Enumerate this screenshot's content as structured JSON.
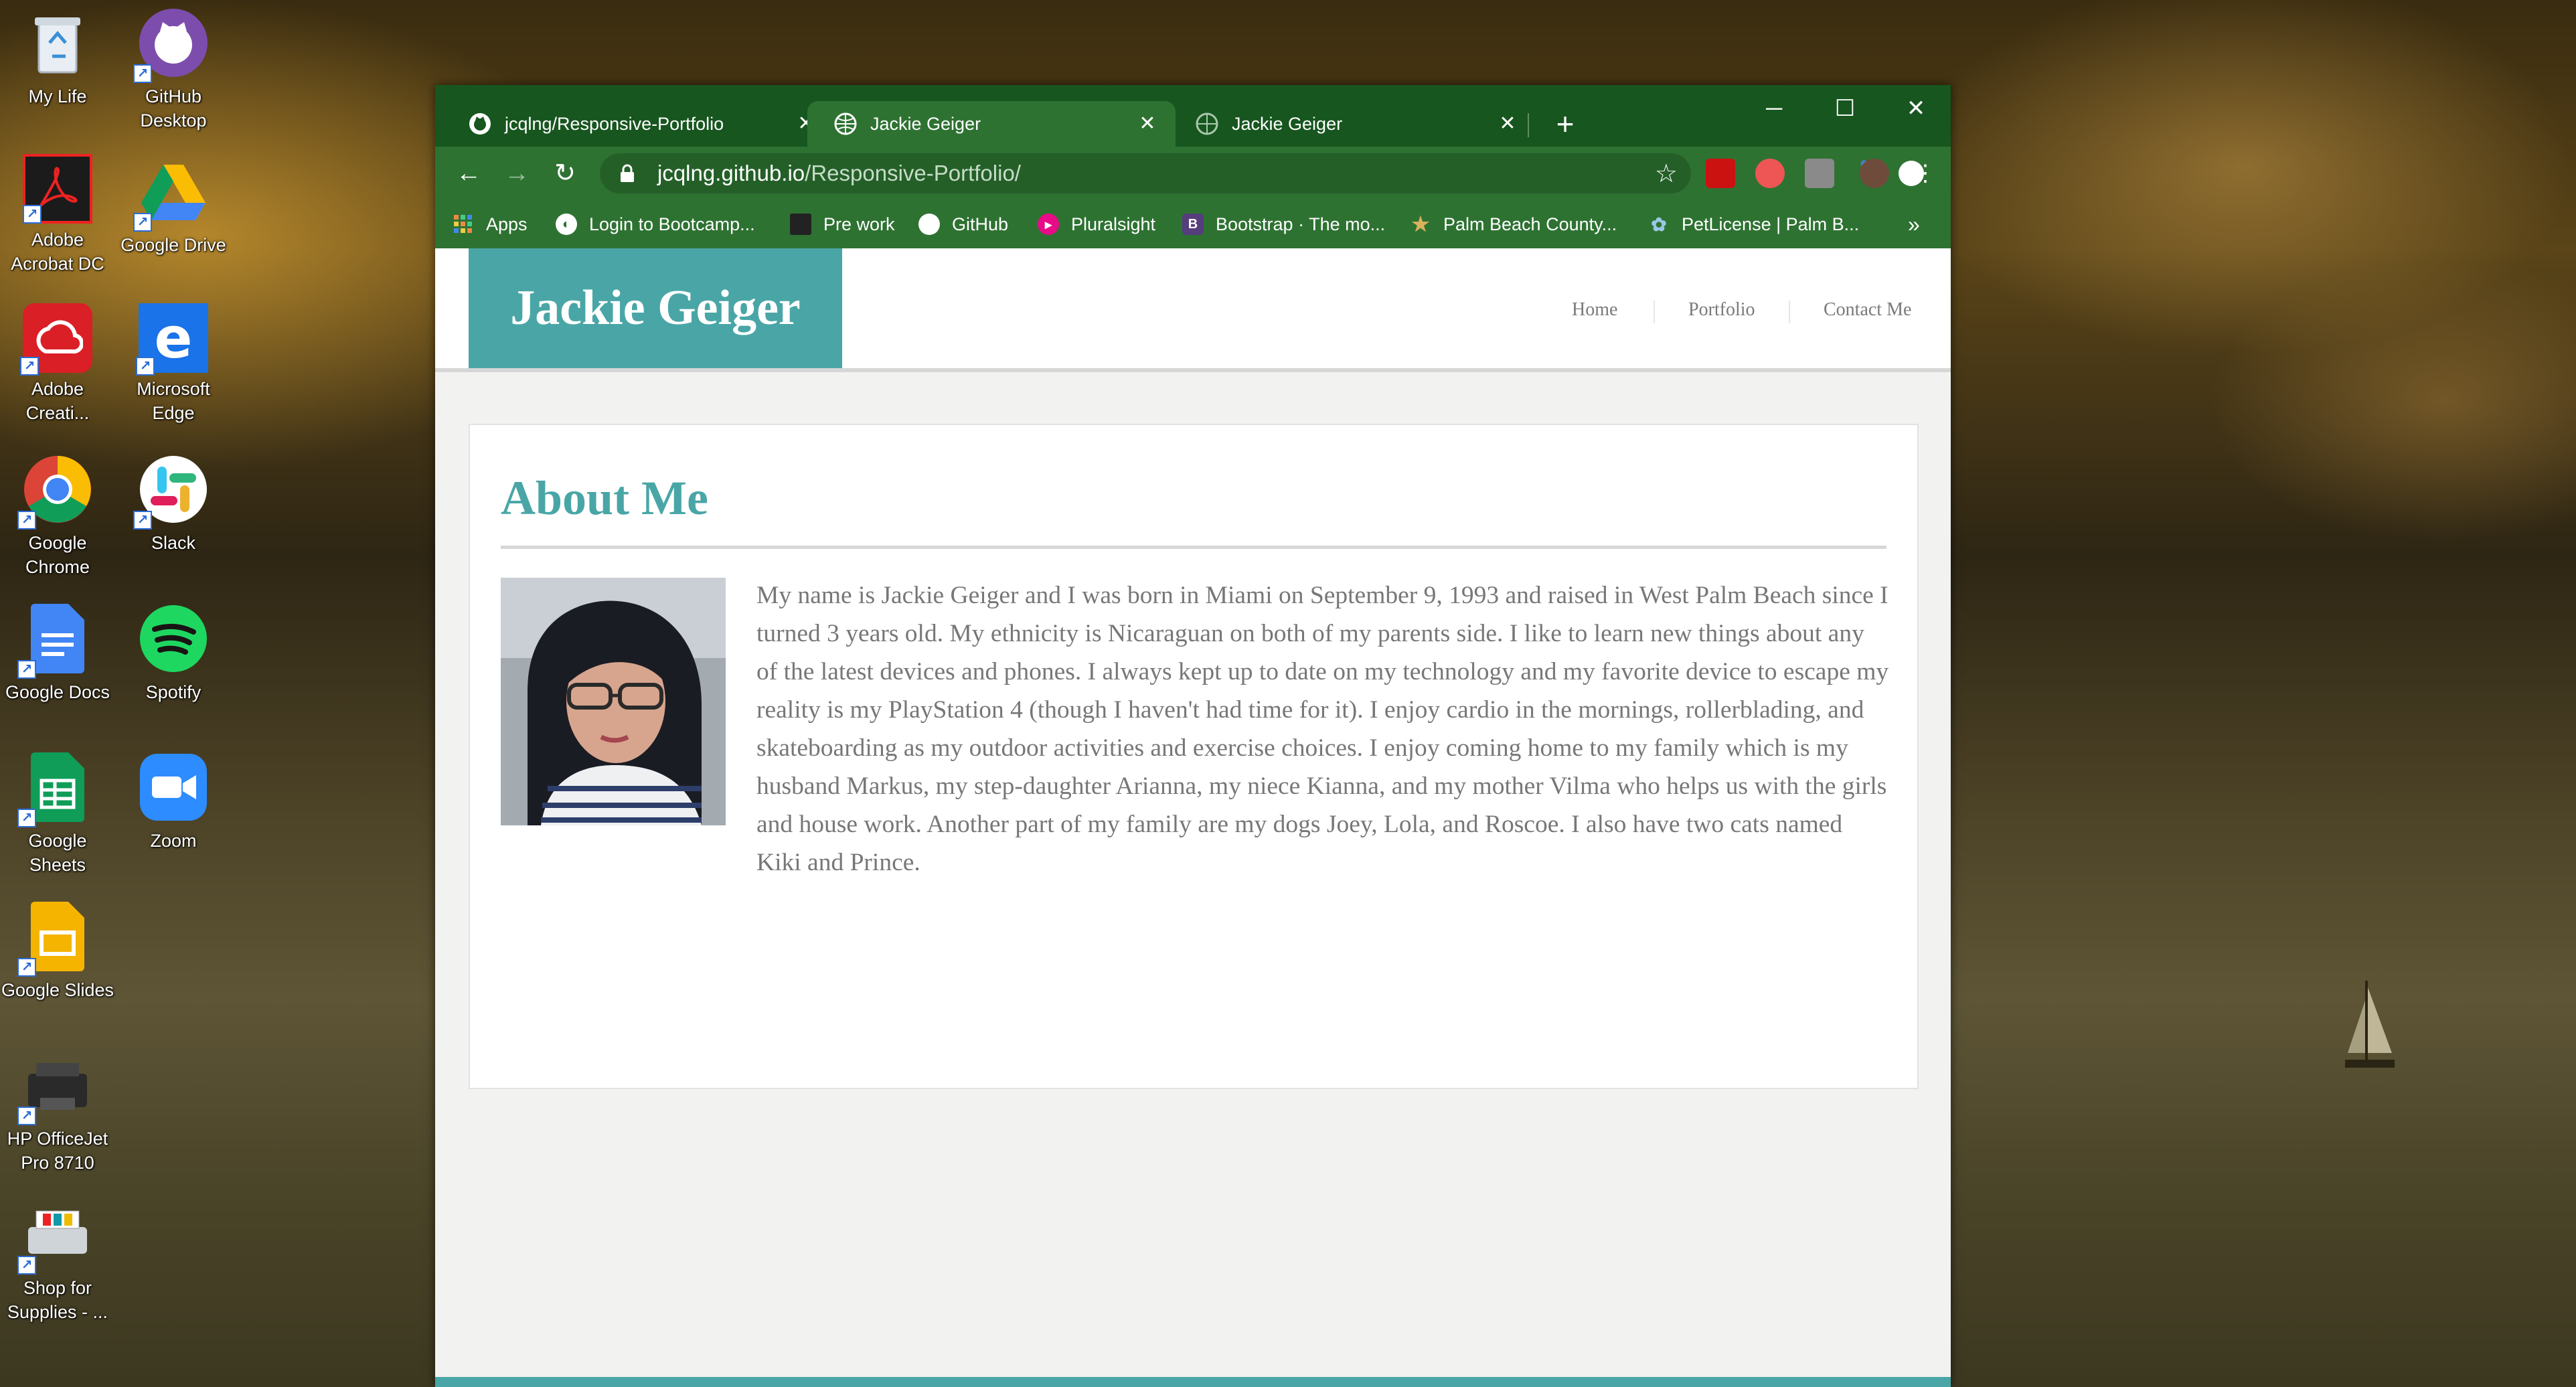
{
  "desktop": {
    "icons": [
      {
        "label_lines": [
          "My Life"
        ]
      },
      {
        "label_lines": [
          "GitHub",
          "Desktop"
        ]
      },
      {
        "label_lines": [
          "Adobe",
          "Acrobat DC"
        ]
      },
      {
        "label_lines": [
          "Google Drive"
        ]
      },
      {
        "label_lines": [
          "Adobe",
          "Creati..."
        ]
      },
      {
        "label_lines": [
          "Microsoft",
          "Edge"
        ]
      },
      {
        "label_lines": [
          "Google",
          "Chrome"
        ]
      },
      {
        "label_lines": [
          "Slack"
        ]
      },
      {
        "label_lines": [
          "Google Docs"
        ]
      },
      {
        "label_lines": [
          "Spotify"
        ]
      },
      {
        "label_lines": [
          "Google",
          "Sheets"
        ]
      },
      {
        "label_lines": [
          "Zoom"
        ]
      },
      {
        "label_lines": [
          "Google Slides"
        ]
      },
      {
        "label_lines": [
          "HP OfficeJet",
          "Pro 8710"
        ]
      },
      {
        "label_lines": [
          "Shop for",
          "Supplies - ..."
        ]
      }
    ]
  },
  "browser": {
    "tabs": [
      {
        "title": "jcqlng/Responsive-Portfolio",
        "icon": "github-icon"
      },
      {
        "title": "Jackie Geiger",
        "icon": "globe-icon"
      },
      {
        "title": "Jackie Geiger",
        "icon": "globe-icon"
      }
    ],
    "url_host": "jcqlng.github.io",
    "url_path": "/Responsive-Portfolio/",
    "bookmarks": [
      {
        "label": "Apps"
      },
      {
        "label": "Login to Bootcamp..."
      },
      {
        "label": "Pre work"
      },
      {
        "label": "GitHub"
      },
      {
        "label": "Pluralsight"
      },
      {
        "label": "Bootstrap · The mo..."
      },
      {
        "label": "Palm Beach County..."
      },
      {
        "label": "PetLicense | Palm B..."
      }
    ],
    "more_bookmarks": "»"
  },
  "site": {
    "brand": "Jackie Geiger",
    "nav": {
      "home": "Home",
      "portfolio": "Portfolio",
      "contact": "Contact Me"
    },
    "heading": "About Me",
    "about_text": "My name is Jackie Geiger and I was born in Miami on September 9, 1993 and raised in West Palm Beach since I turned 3 years old. My ethnicity is Nicaraguan on both of my parents side. I like to learn new things about any of the latest devices and phones. I always kept up to date on my technology and my favorite device to escape my reality is my PlayStation 4 (though I haven't had time for it). I enjoy cardio in the mornings, rollerblading, and skateboarding as my outdoor activities and exercise choices. I enjoy coming home to my family which is my husband Markus, my step-daughter Arianna, my niece Kianna, and my mother Vilma who helps us with the girls and house work. Another part of my family are my dogs Joey, Lola, and Roscoe. I also have two cats named Kiki and Prince."
  },
  "colors": {
    "accent_teal": "#4aa6a6",
    "browser_green": "#2e7232"
  }
}
